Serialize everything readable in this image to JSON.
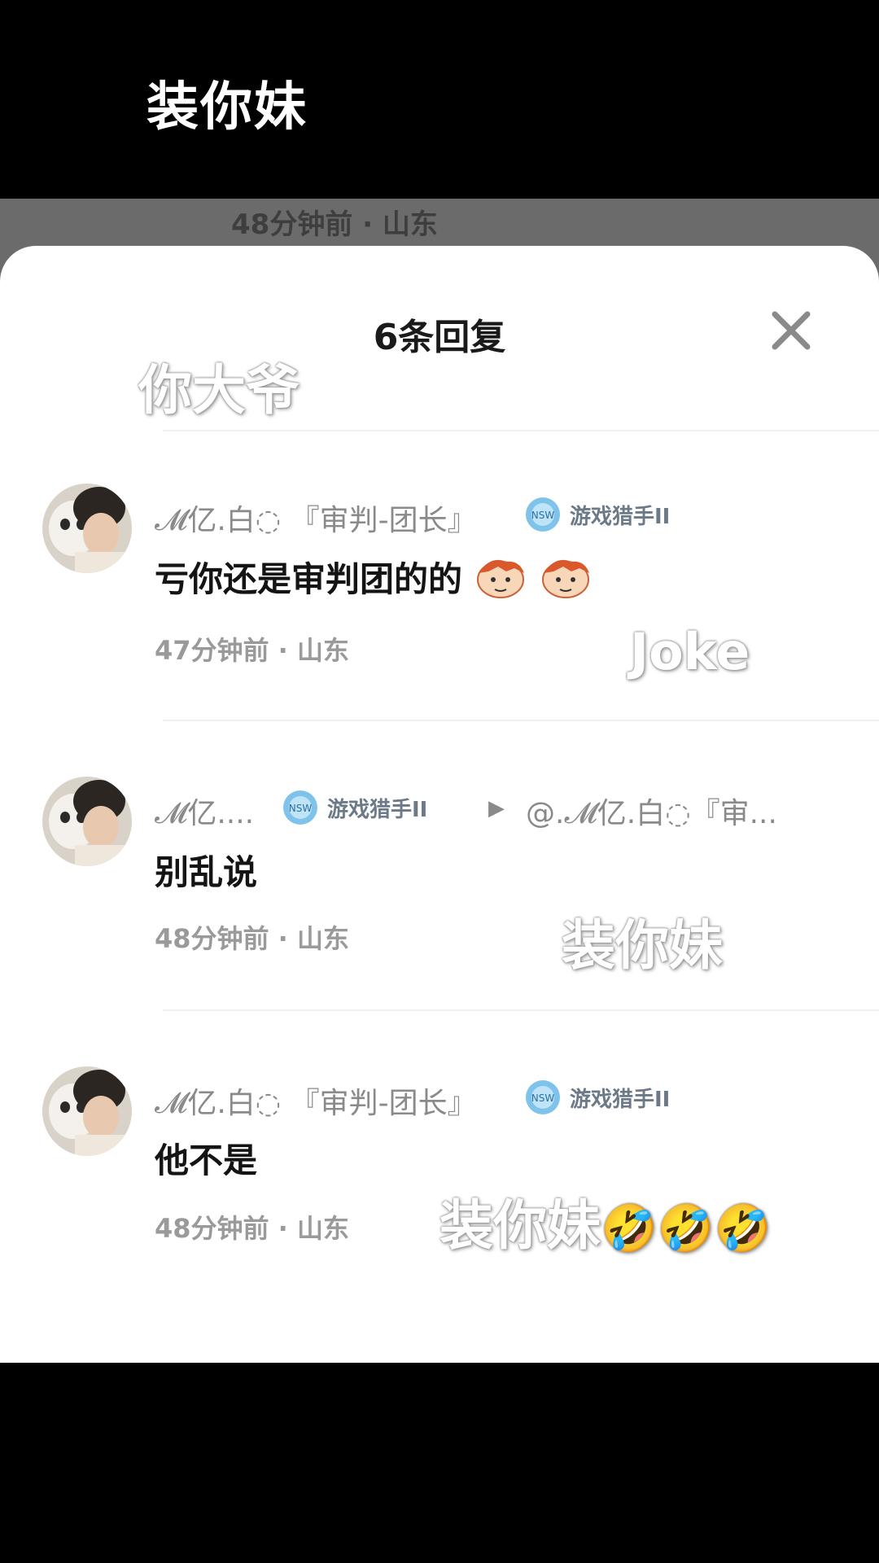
{
  "caption_top": "装你妹",
  "behind": {
    "meta": "48分钟前 · 山东"
  },
  "sheet": {
    "title": "6条回复"
  },
  "comments": [
    {
      "username": "𝓜亿.白◌ 『审判-团长』",
      "badge": "游戏猎手II",
      "text": "亏你还是审判团的的",
      "emoji_count": 2,
      "meta": "47分钟前 · 山东"
    },
    {
      "username": "𝓜亿....",
      "badge": "游戏猎手II",
      "reply_to": "@.𝓜亿.白◌『审...",
      "text": "别乱说",
      "meta": "48分钟前 · 山东"
    },
    {
      "username": "𝓜亿.白◌ 『审判-团长』",
      "badge": "游戏猎手II",
      "text": "他不是",
      "meta": "48分钟前 · 山东"
    }
  ],
  "overlays": {
    "o1": "你大爷",
    "o2": "Joke",
    "o3": "装你妹",
    "o4": "装你妹",
    "o4_emoji": "🤣🤣🤣"
  },
  "colors": {
    "badge_fill": "#7fc3ea",
    "meta_gray": "#9a9a9a",
    "sheet_bg": "#ffffff"
  }
}
